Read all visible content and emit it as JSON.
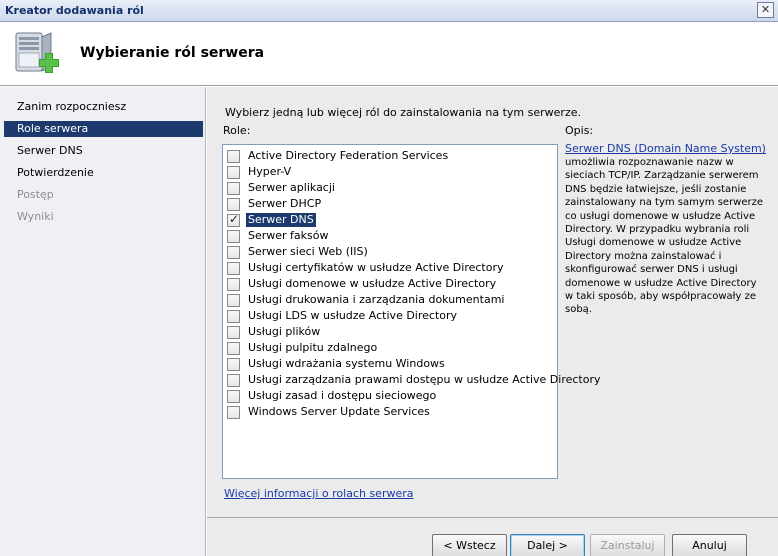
{
  "window": {
    "title": "Kreator dodawania ról",
    "close_symbol": "✕"
  },
  "header": {
    "title": "Wybieranie ról serwera",
    "icon": "server-add-icon"
  },
  "nav": {
    "items": [
      {
        "label": "Zanim rozpoczniesz",
        "state": "normal"
      },
      {
        "label": "Role serwera",
        "state": "active"
      },
      {
        "label": "Serwer DNS",
        "state": "normal"
      },
      {
        "label": "Potwierdzenie",
        "state": "normal"
      },
      {
        "label": "Postęp",
        "state": "disabled"
      },
      {
        "label": "Wyniki",
        "state": "disabled"
      }
    ]
  },
  "main": {
    "instruction": "Wybierz jedną lub więcej ról do zainstalowania na tym serwerze.",
    "roles_label": "Role:",
    "roles": [
      {
        "label": "Active Directory Federation Services",
        "checked": false,
        "selected": false
      },
      {
        "label": "Hyper-V",
        "checked": false,
        "selected": false
      },
      {
        "label": "Serwer aplikacji",
        "checked": false,
        "selected": false
      },
      {
        "label": "Serwer DHCP",
        "checked": false,
        "selected": false
      },
      {
        "label": "Serwer DNS",
        "checked": true,
        "selected": true
      },
      {
        "label": "Serwer faksów",
        "checked": false,
        "selected": false
      },
      {
        "label": "Serwer sieci Web (IIS)",
        "checked": false,
        "selected": false
      },
      {
        "label": "Usługi certyfikatów w usłudze Active Directory",
        "checked": false,
        "selected": false
      },
      {
        "label": "Usługi domenowe w usłudze Active Directory",
        "checked": false,
        "selected": false
      },
      {
        "label": "Usługi drukowania i zarządzania dokumentami",
        "checked": false,
        "selected": false
      },
      {
        "label": "Usługi LDS w usłudze Active Directory",
        "checked": false,
        "selected": false
      },
      {
        "label": "Usługi plików",
        "checked": false,
        "selected": false
      },
      {
        "label": "Usługi pulpitu zdalnego",
        "checked": false,
        "selected": false
      },
      {
        "label": "Usługi wdrażania systemu Windows",
        "checked": false,
        "selected": false
      },
      {
        "label": "Usługi zarządzania prawami dostępu w usłudze Active Directory",
        "checked": false,
        "selected": false
      },
      {
        "label": "Usługi zasad i dostępu sieciowego",
        "checked": false,
        "selected": false
      },
      {
        "label": "Windows Server Update Services",
        "checked": false,
        "selected": false
      }
    ],
    "description_label": "Opis:",
    "description_link": "Serwer DNS (Domain Name System)",
    "description_text": "umożliwia rozpoznawanie nazw w sieciach TCP/IP. Zarządzanie serwerem DNS będzie łatwiejsze, jeśli zostanie zainstalowany na tym samym serwerze co usługi domenowe w usłudze Active Directory. W przypadku wybrania roli Usługi domenowe w usłudze Active Directory można zainstalować i skonfigurować serwer DNS i usługi domenowe w usłudze Active Directory w taki sposób, aby współpracowały ze sobą.",
    "more_info_link": "Więcej informacji o rolach serwera"
  },
  "footer": {
    "back_label": "< Wstecz",
    "next_label": "Dalej >",
    "install_label": "Zainstaluj",
    "cancel_label": "Anuluj"
  }
}
